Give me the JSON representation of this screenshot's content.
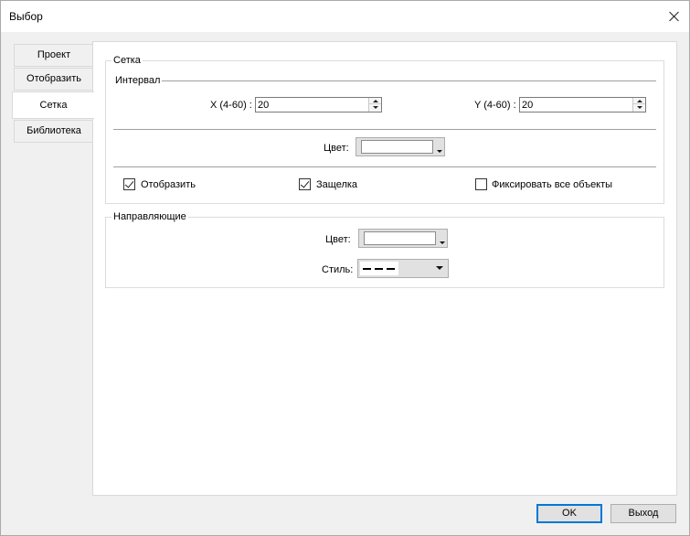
{
  "window": {
    "title": "Выбор"
  },
  "tabs": [
    {
      "label": "Проект",
      "active": false
    },
    {
      "label": "Отобразить",
      "active": false
    },
    {
      "label": "Сетка",
      "active": true
    },
    {
      "label": "Библиотека",
      "active": false
    }
  ],
  "grid": {
    "group_label": "Сетка",
    "interval_label": "Интервал",
    "x": {
      "label": "X (4-60) :",
      "value": "20"
    },
    "y": {
      "label": "Y (4-60) :",
      "value": "20"
    },
    "color": {
      "label": "Цвет:",
      "value": "#ffffff"
    },
    "show": {
      "label": "Отобразить",
      "checked": true
    },
    "snap": {
      "label": "Защелка",
      "checked": true
    },
    "lock_all": {
      "label": "Фиксировать все объекты",
      "checked": false
    }
  },
  "guides": {
    "group_label": "Направляющие",
    "color": {
      "label": "Цвет:",
      "value": "#ffffff"
    },
    "style": {
      "label": "Стиль:",
      "value": "dashed"
    }
  },
  "buttons": {
    "ok": "OK",
    "exit": "Выход"
  },
  "colors": {
    "accent": "#0078d7",
    "panel_bg": "#ffffff",
    "window_bg": "#f0f0f0"
  }
}
